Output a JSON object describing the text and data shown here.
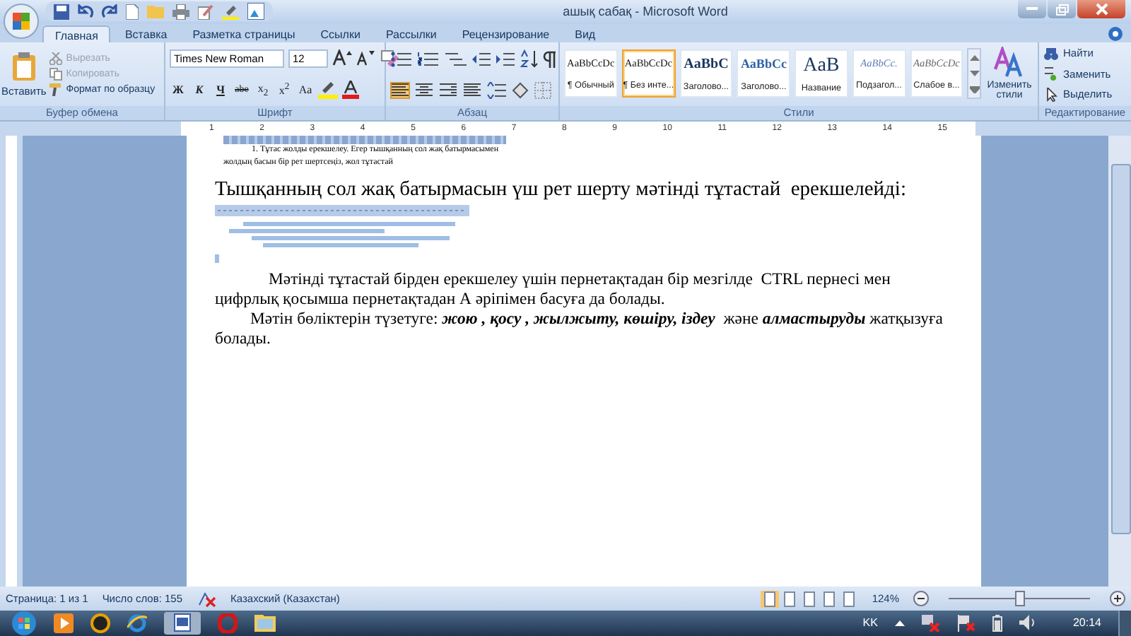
{
  "window": {
    "title": "ашық сабақ - Microsoft Word"
  },
  "tabs": [
    {
      "label": "Главная",
      "selected": true
    },
    {
      "label": "Вставка",
      "selected": false
    },
    {
      "label": "Разметка страницы",
      "selected": false
    },
    {
      "label": "Ссылки",
      "selected": false
    },
    {
      "label": "Рассылки",
      "selected": false
    },
    {
      "label": "Рецензирование",
      "selected": false
    },
    {
      "label": "Вид",
      "selected": false
    }
  ],
  "clipboard": {
    "paste": "Вставить",
    "items": [
      {
        "label": "Вырезать",
        "disabled": true
      },
      {
        "label": "Копировать",
        "disabled": true
      },
      {
        "label": "Формат по образцу",
        "disabled": false
      }
    ],
    "group": "Буфер обмена"
  },
  "font": {
    "name": "Times New Roman",
    "size": "12",
    "format_buttons": [
      "Ж",
      "К",
      "Ч",
      "abe",
      "x$_{2}$",
      "x$^{2}$",
      "Aa"
    ],
    "group": "Шрифт"
  },
  "paragraph": {
    "alignments": [
      {
        "selected": true
      },
      {
        "selected": false
      },
      {
        "selected": false
      },
      {
        "selected": false
      }
    ],
    "group": "Абзац"
  },
  "styles": {
    "items": [
      {
        "preview": "AaBbCcDc",
        "name": "¶ Обычный",
        "selected": false
      },
      {
        "preview": "AaBbCcDc",
        "name": "¶ Без инте...",
        "selected": true
      },
      {
        "preview": "AaBbC",
        "name": "Заголово...",
        "selected": false
      },
      {
        "preview": "AaBbCc",
        "name": "Заголово...",
        "selected": false
      },
      {
        "preview": "AaB",
        "name": "Название",
        "selected": false
      },
      {
        "preview": "AaBbCc.",
        "name": "Подзагол...",
        "selected": false
      },
      {
        "preview": "AaBbCcDc",
        "name": "Слабое в...",
        "selected": false
      }
    ],
    "change": "Изменить стили",
    "group": "Стили"
  },
  "editing": {
    "items": [
      "Найти",
      "Заменить",
      "Выделить"
    ],
    "group": "Редактирование"
  },
  "ruler": [
    "1",
    "2",
    "3",
    "4",
    "5",
    "6",
    "7",
    "8",
    "9",
    "10",
    "11",
    "12",
    "13",
    "14",
    "15"
  ],
  "document": {
    "fragment_lines": [
      "1. Тұтас жолды ерекшелеу. Егер тышқанның сол жақ батырмасымен",
      "жолдың басын бір рет шертсеңіз, жол тұтастай"
    ],
    "heading": "Тышқанның сол жақ батырмасын үш рет шерту мәтінді тұтастай  ерекшелейді:",
    "paragraphs": [
      "Мәтінді тұтастай бірден ерекшелеу үшін пернетақтадан бір мезгілде  CTRL пернесі мен цифрлық қосымша пернетақтадан А әріпімен басуға да болады.",
      "Мәтін бөліктерін түзетуге: *жою , қосу , жылжыту, көшіру, іздеу*  және *алмастыруды* жатқызуға болады."
    ]
  },
  "status_bar": {
    "page": "Страница: 1 из 1",
    "words": "Число слов: 155",
    "language": "Казахский (Казахстан)",
    "zoom": "124%",
    "zoom_slider": {
      "level": 0.5
    }
  },
  "taskbar": {
    "language": "KK",
    "time": "20:14"
  }
}
